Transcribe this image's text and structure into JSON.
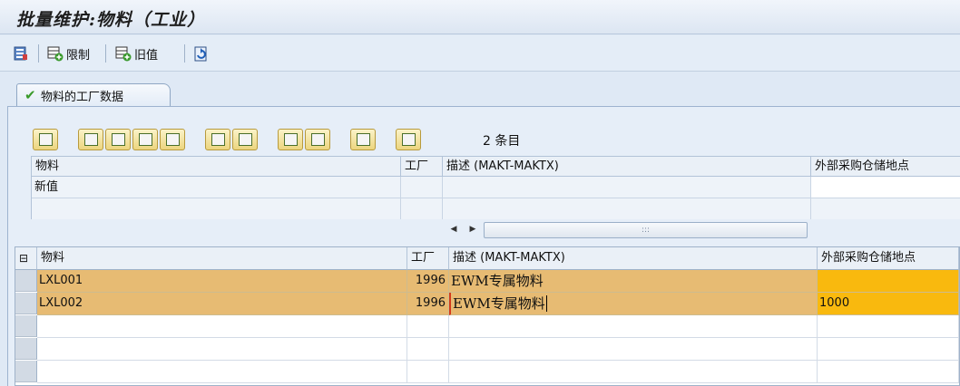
{
  "window": {
    "title": "批量维护:物料（工业）"
  },
  "toolbar": {
    "restrict_label": "限制",
    "old_value_label": "旧值",
    "icons": [
      "grid-settings-icon",
      "restrict-icon",
      "old-value-icon",
      "refresh-icon"
    ]
  },
  "tab": {
    "label": "物料的工厂数据",
    "icon": "checkmark-icon"
  },
  "alv_toolbar": {
    "count_text": "2 条目",
    "icons": [
      "layout-icon",
      "select-all-icon",
      "deselect-icon",
      "insert-row-icon",
      "filter-icon",
      "column-config-icon",
      "undo-icon",
      "sort-asc-icon",
      "sort-desc-icon",
      "sum-icon",
      "print-icon"
    ]
  },
  "new_values_grid": {
    "headers": [
      "物料",
      "工厂",
      "描述 (MAKT-MAKTX)",
      "外部采购仓储地点"
    ],
    "row_label": "新值"
  },
  "data_grid": {
    "headers": [
      "物料",
      "工厂",
      "描述 (MAKT-MAKTX)",
      "外部采购仓储地点"
    ],
    "rows": [
      {
        "material": "LXL001",
        "plant": "1996",
        "description": "EWM专属物料",
        "storage_loc": ""
      },
      {
        "material": "LXL002",
        "plant": "1996",
        "description": "EWM专属物料",
        "storage_loc": "1000"
      }
    ]
  },
  "colors": {
    "row_highlight": "#e7bb73",
    "editable_highlight": "#f9b90e",
    "header_bg": "#eaf0f7"
  }
}
